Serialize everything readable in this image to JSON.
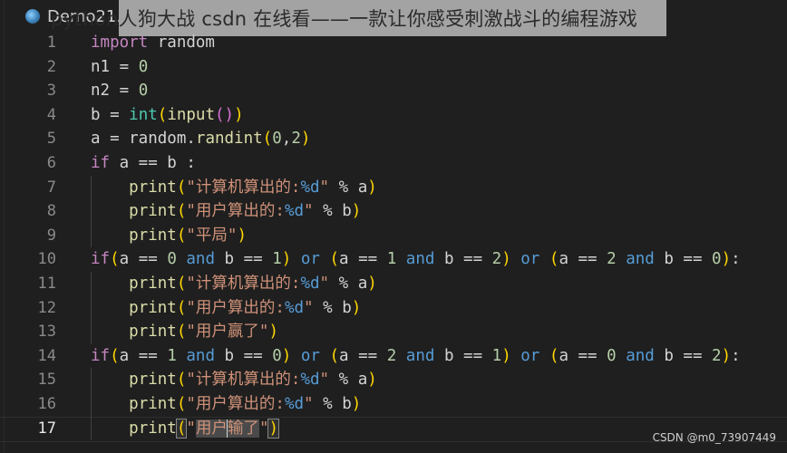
{
  "editor": {
    "tab": {
      "filename": "Demo21.py",
      "icon": "python-file-icon"
    },
    "overlay_title": "python人狗大战 csdn 在线看——一款让你感受刺激战斗的编程游戏",
    "active_line": 17,
    "line_numbers": [
      "1",
      "2",
      "3",
      "4",
      "5",
      "6",
      "7",
      "8",
      "9",
      "10",
      "11",
      "12",
      "13",
      "14",
      "15",
      "16",
      "17"
    ],
    "lines": [
      [
        [
          "kw",
          "import"
        ],
        [
          "var",
          " random"
        ]
      ],
      [
        [
          "var",
          "n1 = "
        ],
        [
          "num",
          "0"
        ]
      ],
      [
        [
          "var",
          "n2 = "
        ],
        [
          "num",
          "0"
        ]
      ],
      [
        [
          "var",
          "b = "
        ],
        [
          "bi",
          "int"
        ],
        [
          "p1",
          "("
        ],
        [
          "fn",
          "input"
        ],
        [
          "p2",
          "()"
        ],
        [
          "p1",
          ")"
        ]
      ],
      [
        [
          "var",
          "a = random."
        ],
        [
          "fn",
          "randint"
        ],
        [
          "p1",
          "("
        ],
        [
          "num",
          "0"
        ],
        [
          "var",
          ","
        ],
        [
          "num",
          "2"
        ],
        [
          "p1",
          ")"
        ]
      ],
      [
        [
          "kw",
          "if"
        ],
        [
          "var",
          " a == b :"
        ]
      ],
      [
        [
          "var",
          "    "
        ],
        [
          "fn",
          "print"
        ],
        [
          "p1",
          "("
        ],
        [
          "str",
          "\"计算机算出的:"
        ],
        [
          "fmt",
          "%d"
        ],
        [
          "str",
          "\""
        ],
        [
          "var",
          " % a"
        ],
        [
          "p1",
          ")"
        ]
      ],
      [
        [
          "var",
          "    "
        ],
        [
          "fn",
          "print"
        ],
        [
          "p1",
          "("
        ],
        [
          "str",
          "\"用户算出的:"
        ],
        [
          "fmt",
          "%d"
        ],
        [
          "str",
          "\""
        ],
        [
          "var",
          " % b"
        ],
        [
          "p1",
          ")"
        ]
      ],
      [
        [
          "var",
          "    "
        ],
        [
          "fn",
          "print"
        ],
        [
          "p1",
          "("
        ],
        [
          "str",
          "\"平局\""
        ],
        [
          "p1",
          ")"
        ]
      ],
      [
        [
          "kw",
          "if"
        ],
        [
          "p1",
          "("
        ],
        [
          "var",
          "a == "
        ],
        [
          "num",
          "0"
        ],
        [
          "logic",
          " and"
        ],
        [
          "var",
          " b == "
        ],
        [
          "num",
          "1"
        ],
        [
          "p1",
          ")"
        ],
        [
          "logic",
          " or"
        ],
        [
          "var",
          " "
        ],
        [
          "p1",
          "("
        ],
        [
          "var",
          "a == "
        ],
        [
          "num",
          "1"
        ],
        [
          "logic",
          " and"
        ],
        [
          "var",
          " b == "
        ],
        [
          "num",
          "2"
        ],
        [
          "p1",
          ")"
        ],
        [
          "logic",
          " or"
        ],
        [
          "var",
          " "
        ],
        [
          "p1",
          "("
        ],
        [
          "var",
          "a == "
        ],
        [
          "num",
          "2"
        ],
        [
          "logic",
          " and"
        ],
        [
          "var",
          " b == "
        ],
        [
          "num",
          "0"
        ],
        [
          "p1",
          ")"
        ],
        [
          "var",
          ":"
        ]
      ],
      [
        [
          "var",
          "    "
        ],
        [
          "fn",
          "print"
        ],
        [
          "p1",
          "("
        ],
        [
          "str",
          "\"计算机算出的:"
        ],
        [
          "fmt",
          "%d"
        ],
        [
          "str",
          "\""
        ],
        [
          "var",
          " % a"
        ],
        [
          "p1",
          ")"
        ]
      ],
      [
        [
          "var",
          "    "
        ],
        [
          "fn",
          "print"
        ],
        [
          "p1",
          "("
        ],
        [
          "str",
          "\"用户算出的:"
        ],
        [
          "fmt",
          "%d"
        ],
        [
          "str",
          "\""
        ],
        [
          "var",
          " % b"
        ],
        [
          "p1",
          ")"
        ]
      ],
      [
        [
          "var",
          "    "
        ],
        [
          "fn",
          "print"
        ],
        [
          "p1",
          "("
        ],
        [
          "str",
          "\"用户赢了\""
        ],
        [
          "p1",
          ")"
        ]
      ],
      [
        [
          "kw",
          "if"
        ],
        [
          "p1",
          "("
        ],
        [
          "var",
          "a == "
        ],
        [
          "num",
          "1"
        ],
        [
          "logic",
          " and"
        ],
        [
          "var",
          " b == "
        ],
        [
          "num",
          "0"
        ],
        [
          "p1",
          ")"
        ],
        [
          "logic",
          " or"
        ],
        [
          "var",
          " "
        ],
        [
          "p1",
          "("
        ],
        [
          "var",
          "a == "
        ],
        [
          "num",
          "2"
        ],
        [
          "logic",
          " and"
        ],
        [
          "var",
          " b == "
        ],
        [
          "num",
          "1"
        ],
        [
          "p1",
          ")"
        ],
        [
          "logic",
          " or"
        ],
        [
          "var",
          " "
        ],
        [
          "p1",
          "("
        ],
        [
          "var",
          "a == "
        ],
        [
          "num",
          "0"
        ],
        [
          "logic",
          " and"
        ],
        [
          "var",
          " b == "
        ],
        [
          "num",
          "2"
        ],
        [
          "p1",
          ")"
        ],
        [
          "var",
          ":"
        ]
      ],
      [
        [
          "var",
          "    "
        ],
        [
          "fn",
          "print"
        ],
        [
          "p1",
          "("
        ],
        [
          "str",
          "\"计算机算出的:"
        ],
        [
          "fmt",
          "%d"
        ],
        [
          "str",
          "\""
        ],
        [
          "var",
          " % a"
        ],
        [
          "p1",
          ")"
        ]
      ],
      [
        [
          "var",
          "    "
        ],
        [
          "fn",
          "print"
        ],
        [
          "p1",
          "("
        ],
        [
          "str",
          "\"用户算出的:"
        ],
        [
          "fmt",
          "%d"
        ],
        [
          "str",
          "\""
        ],
        [
          "var",
          " % b"
        ],
        [
          "p1",
          ")"
        ]
      ],
      [
        [
          "var",
          "    "
        ],
        [
          "fn",
          "print"
        ],
        [
          "p1 bracket-match",
          "("
        ],
        [
          "str",
          "\""
        ],
        [
          "str hl",
          "用户"
        ],
        [
          "caret",
          ""
        ],
        [
          "str hl",
          "输了"
        ],
        [
          "str",
          "\""
        ],
        [
          "p1 bracket-match",
          ")"
        ]
      ]
    ]
  },
  "watermark": "CSDN @m0_73907449"
}
